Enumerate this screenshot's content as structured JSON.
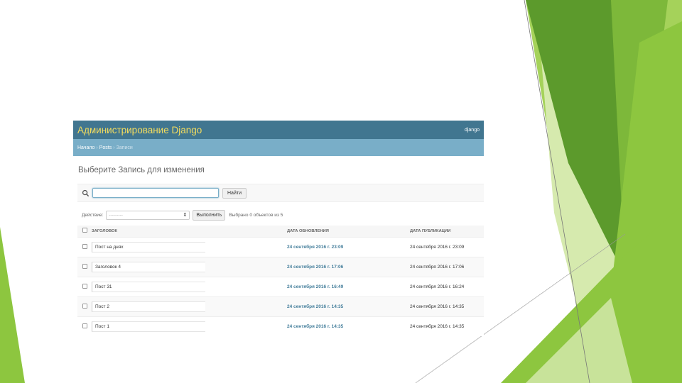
{
  "admin": {
    "brand": "Администрирование Django",
    "user": "django",
    "breadcrumb": {
      "home": "Начало",
      "sep1": "›",
      "app": "Posts",
      "sep2": "›",
      "current": "Записи"
    },
    "page_title": "Выберите Запись для изменения",
    "search": {
      "value": "",
      "button": "Найти"
    },
    "actions": {
      "label": "Действие:",
      "selected": "---------",
      "go": "Выполнить",
      "count": "Выбрано 0 объектов из 5"
    },
    "columns": [
      "Заголовок",
      "Дата обновления",
      "Дата публикации"
    ],
    "rows": [
      {
        "title": "Пост на днях",
        "updated": "24 сентября 2016 г. 23:09",
        "published": "24 сентября 2016 г. 23:09"
      },
      {
        "title": "Заголовок 4",
        "updated": "24 сентября 2016 г. 17:06",
        "published": "24 сентября 2016 г. 17:06"
      },
      {
        "title": "Пост 31",
        "updated": "24 сентября 2016 г. 16:49",
        "published": "24 сентября 2016 г. 16:24"
      },
      {
        "title": "Пост 2",
        "updated": "24 сентября 2016 г. 14:35",
        "published": "24 сентября 2016 г. 14:35"
      },
      {
        "title": "Пост 1",
        "updated": "24 сентября 2016 г. 14:35",
        "published": "24 сентября 2016 г. 14:35"
      }
    ]
  },
  "colors": {
    "header_bg": "#417690",
    "brand_text": "#f5dd5d",
    "breadcrumb_bg": "#79aec8",
    "link": "#447e9b",
    "slide_green_dark": "#5c9a2c",
    "slide_green_light": "#8dc63f"
  }
}
